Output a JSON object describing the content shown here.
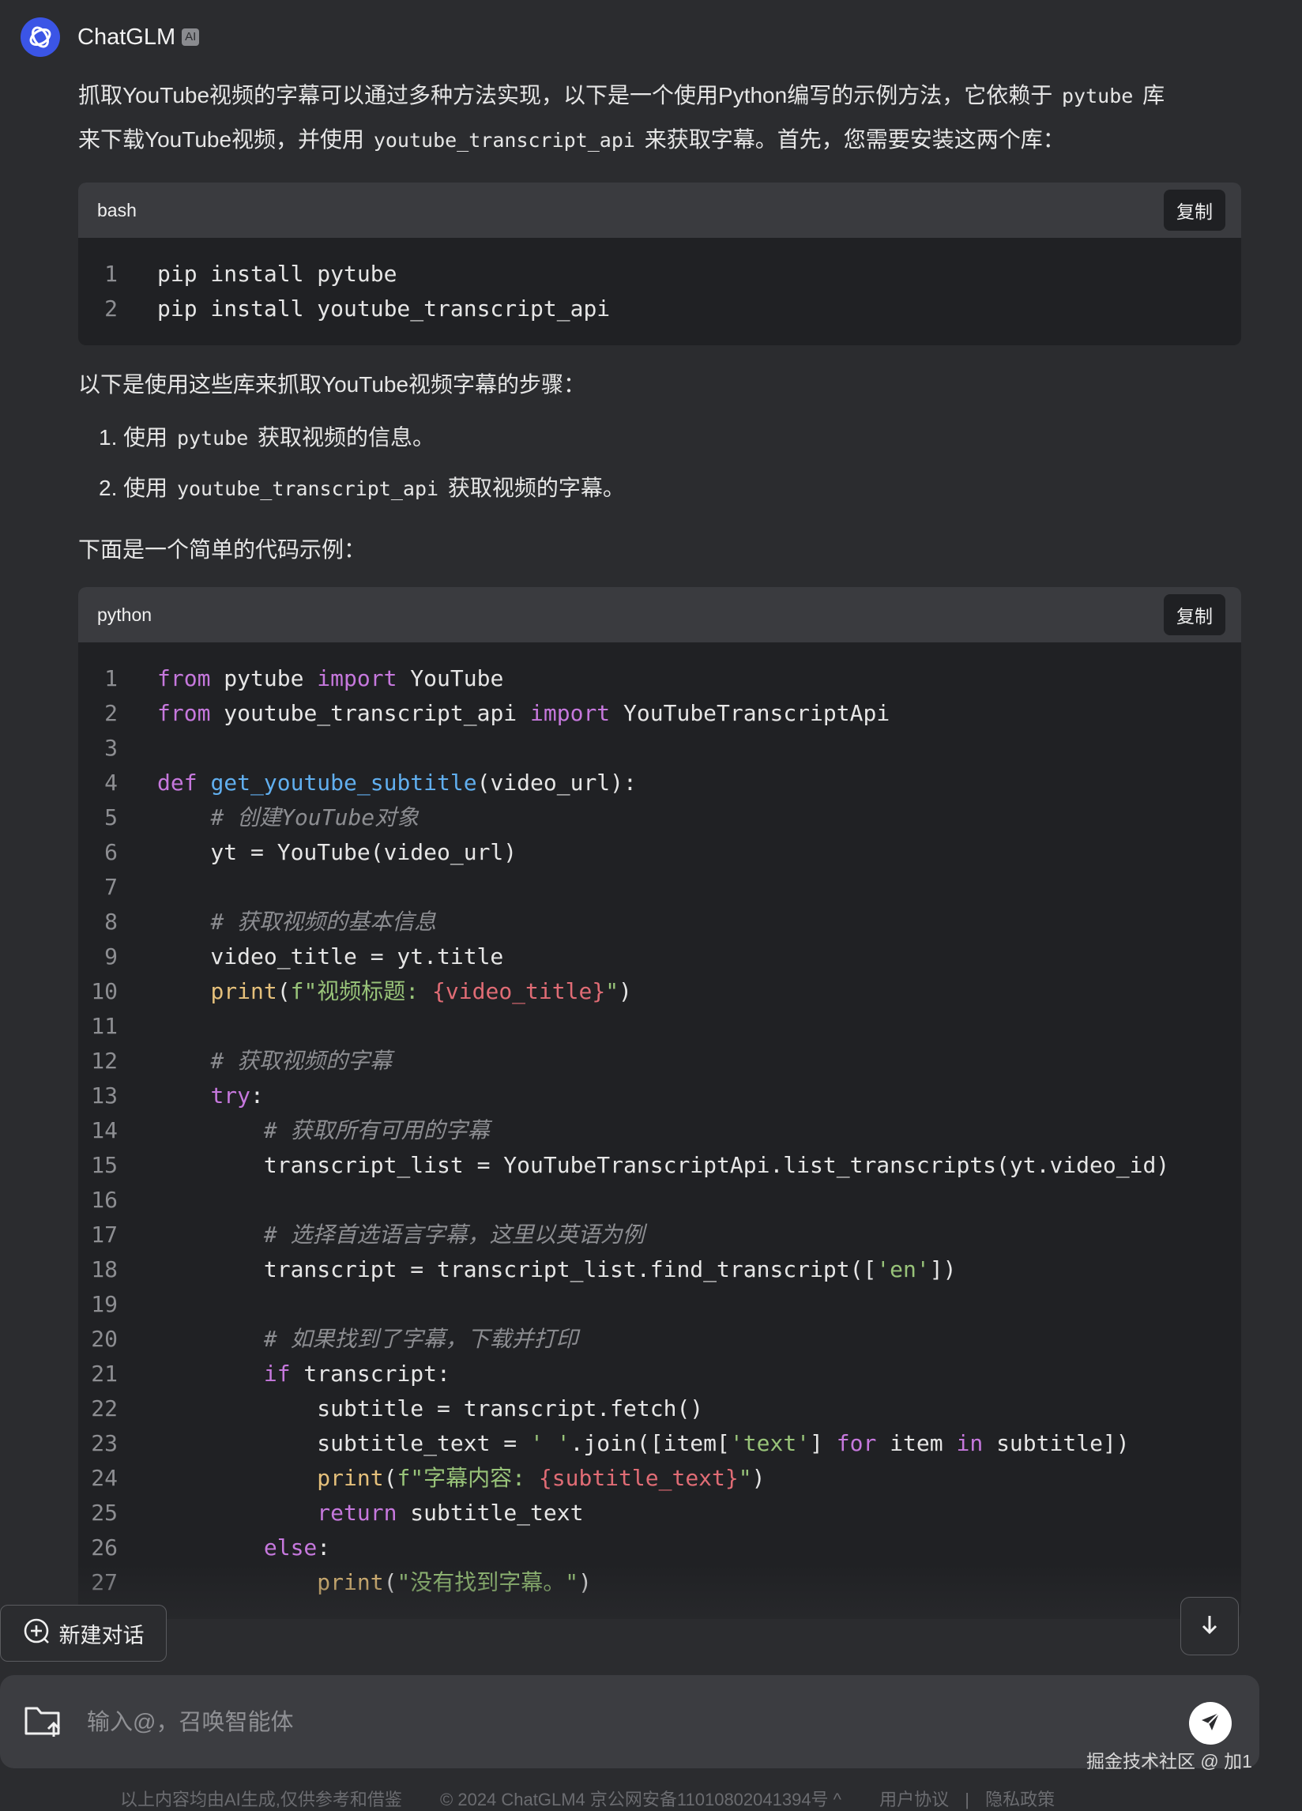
{
  "header": {
    "app_name": "ChatGLM",
    "badge": "AI"
  },
  "message": {
    "intro_1": "抓取YouTube视频的字幕可以通过多种方法实现，以下是一个使用Python编写的示例方法，它依赖于",
    "intro_code_1": "pytube",
    "intro_2": "库",
    "intro_3": "来下载YouTube视频，并使用",
    "intro_code_2": "youtube_transcript_api",
    "intro_4": "来获取字幕。首先，您需要安装这两个库：",
    "bash_block": {
      "lang": "bash",
      "copy_label": "复制",
      "lines": [
        "pip install pytube",
        "pip install youtube_transcript_api"
      ]
    },
    "steps_intro": "以下是使用这些库来抓取YouTube视频字幕的步骤：",
    "steps": [
      {
        "num": "1.",
        "pre": "使用",
        "code": "pytube",
        "post": "获取视频的信息。"
      },
      {
        "num": "2.",
        "pre": "使用",
        "code": "youtube_transcript_api",
        "post": "获取视频的字幕。"
      }
    ],
    "example_intro": "下面是一个简单的代码示例：",
    "python_block": {
      "lang": "python",
      "copy_label": "复制",
      "lines": [
        [
          [
            "kw",
            "from"
          ],
          [
            "tx",
            " pytube "
          ],
          [
            "kw",
            "import"
          ],
          [
            "tx",
            " YouTube"
          ]
        ],
        [
          [
            "kw",
            "from"
          ],
          [
            "tx",
            " youtube_transcript_api "
          ],
          [
            "kw",
            "import"
          ],
          [
            "tx",
            " YouTubeTranscriptApi"
          ]
        ],
        [],
        [
          [
            "kw",
            "def"
          ],
          [
            "tx",
            " "
          ],
          [
            "fn",
            "get_youtube_subtitle"
          ],
          [
            "tx",
            "(video_url):"
          ]
        ],
        [
          [
            "tx",
            "    "
          ],
          [
            "cm",
            "# 创建YouTube对象"
          ]
        ],
        [
          [
            "tx",
            "    yt = YouTube(video_url)"
          ]
        ],
        [],
        [
          [
            "tx",
            "    "
          ],
          [
            "cm",
            "# 获取视频的基本信息"
          ]
        ],
        [
          [
            "tx",
            "    video_title = yt.title"
          ]
        ],
        [
          [
            "tx",
            "    "
          ],
          [
            "bi",
            "print"
          ],
          [
            "tx",
            "("
          ],
          [
            "st",
            "f\"视频标题: "
          ],
          [
            "sp",
            "{video_title}"
          ],
          [
            "st",
            "\""
          ],
          [
            "tx",
            ")"
          ]
        ],
        [],
        [
          [
            "tx",
            "    "
          ],
          [
            "cm",
            "# 获取视频的字幕"
          ]
        ],
        [
          [
            "tx",
            "    "
          ],
          [
            "kw",
            "try"
          ],
          [
            "tx",
            ":"
          ]
        ],
        [
          [
            "tx",
            "        "
          ],
          [
            "cm",
            "# 获取所有可用的字幕"
          ]
        ],
        [
          [
            "tx",
            "        transcript_list = YouTubeTranscriptApi.list_transcripts(yt.video_id)"
          ]
        ],
        [],
        [
          [
            "tx",
            "        "
          ],
          [
            "cm",
            "# 选择首选语言字幕，这里以英语为例"
          ]
        ],
        [
          [
            "tx",
            "        transcript = transcript_list.find_transcript(["
          ],
          [
            "st",
            "'en'"
          ],
          [
            "tx",
            "])"
          ]
        ],
        [],
        [
          [
            "tx",
            "        "
          ],
          [
            "cm",
            "# 如果找到了字幕，下载并打印"
          ]
        ],
        [
          [
            "tx",
            "        "
          ],
          [
            "kw",
            "if"
          ],
          [
            "tx",
            " transcript:"
          ]
        ],
        [
          [
            "tx",
            "            subtitle = transcript.fetch()"
          ]
        ],
        [
          [
            "tx",
            "            subtitle_text = "
          ],
          [
            "st",
            "' '"
          ],
          [
            "tx",
            ".join([item["
          ],
          [
            "st",
            "'text'"
          ],
          [
            "tx",
            "] "
          ],
          [
            "kw",
            "for"
          ],
          [
            "tx",
            " item "
          ],
          [
            "kw",
            "in"
          ],
          [
            "tx",
            " subtitle])"
          ]
        ],
        [
          [
            "tx",
            "            "
          ],
          [
            "bi",
            "print"
          ],
          [
            "tx",
            "("
          ],
          [
            "st",
            "f\"字幕内容: "
          ],
          [
            "sp",
            "{subtitle_text}"
          ],
          [
            "st",
            "\""
          ],
          [
            "tx",
            ")"
          ]
        ],
        [
          [
            "tx",
            "            "
          ],
          [
            "kw",
            "return"
          ],
          [
            "tx",
            " subtitle_text"
          ]
        ],
        [
          [
            "tx",
            "        "
          ],
          [
            "kw",
            "else"
          ],
          [
            "tx",
            ":"
          ]
        ],
        [
          [
            "tx",
            "            "
          ],
          [
            "bi",
            "print"
          ],
          [
            "tx",
            "("
          ],
          [
            "st",
            "\"没有找到字幕。\""
          ],
          [
            "tx",
            ")"
          ]
        ]
      ]
    }
  },
  "new_chat_label": "新建对话",
  "input": {
    "placeholder": "输入@，召唤智能体"
  },
  "watermark": "掘金技术社区 @ 加1",
  "footer": {
    "disclaimer": "以上内容均由AI生成,仅供参考和借鉴",
    "copyright": "© 2024 ChatGLM4 京公网安备11010802041394号 ^",
    "user_agreement": "用户协议",
    "separator": "|",
    "privacy": "隐私政策"
  }
}
